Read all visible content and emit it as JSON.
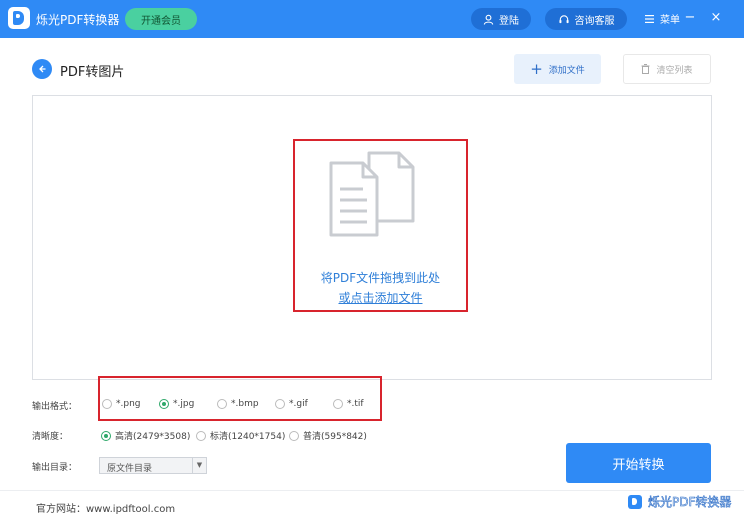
{
  "titlebar": {
    "app_name": "烁光PDF转换器",
    "vip_label": "开通会员",
    "login_label": "登陆",
    "service_label": "咨询客服",
    "menu_label": "菜单",
    "min_symbol": "−",
    "close_symbol": "×"
  },
  "page": {
    "title": "PDF转图片",
    "add_file_label": "添加文件",
    "clear_list_label": "清空列表"
  },
  "dropzone": {
    "line1": "将PDF文件拖拽到此处",
    "line2": "或点击添加文件"
  },
  "output_format": {
    "label": "输出格式：",
    "options": [
      "*.png",
      "*.jpg",
      "*.bmp",
      "*.gif",
      "*.tif"
    ],
    "selected": "*.jpg"
  },
  "clarity": {
    "label": "清晰度：",
    "options": [
      "高清(2479*3508)",
      "标清(1240*1754)",
      "普清(595*842)"
    ],
    "selected": "高清(2479*3508)"
  },
  "output_dir": {
    "label": "输出目录：",
    "value": "原文件目录"
  },
  "actions": {
    "start_label": "开始转换"
  },
  "footer": {
    "website": "官方网站：www.ipdftool.com",
    "watermark": "烁光PDF转换器"
  },
  "colors": {
    "primary": "#2f8af5",
    "vip": "#4ad0a0",
    "highlight_border": "#d8242d",
    "radio_selected": "#2fa86a"
  },
  "icons": {
    "back": "arrow-left-icon",
    "add": "plus-icon",
    "clear": "trash-icon",
    "login": "user-icon",
    "service": "headset-icon",
    "menu": "hamburger-icon",
    "drop": "documents-icon"
  }
}
